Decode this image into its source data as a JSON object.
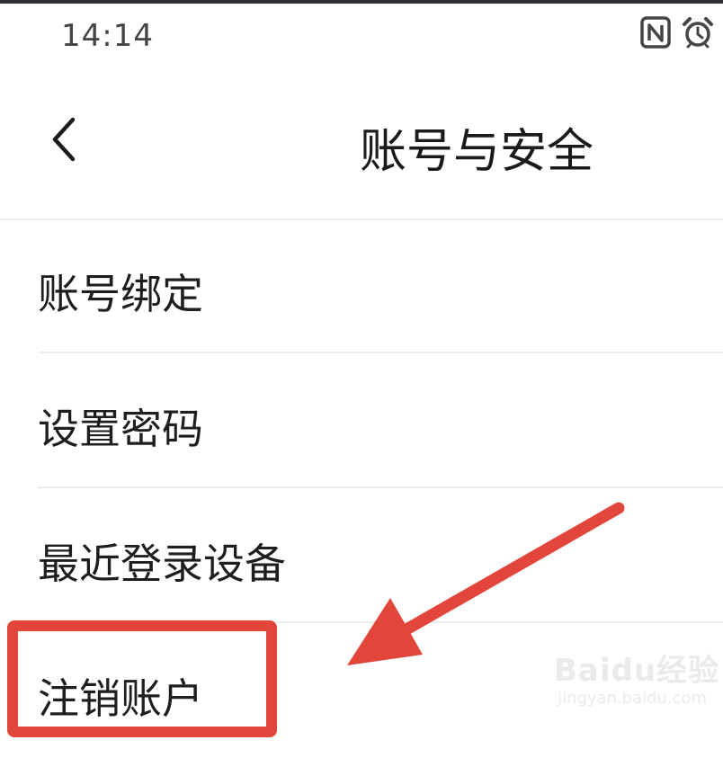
{
  "status_bar": {
    "time": "14:14",
    "icons": [
      "nfc-icon",
      "alarm-icon"
    ]
  },
  "header": {
    "back_icon": "chevron-left-icon",
    "title": "账号与安全"
  },
  "menu": {
    "items": [
      {
        "label": "账号绑定"
      },
      {
        "label": "设置密码"
      },
      {
        "label": "最近登录设备"
      },
      {
        "label": "注销账户"
      }
    ]
  },
  "annotation": {
    "color": "#e2453a",
    "target": "注销账户"
  },
  "watermark": {
    "brand": "Baidu经验",
    "url": "jingyan.baidu.com"
  }
}
